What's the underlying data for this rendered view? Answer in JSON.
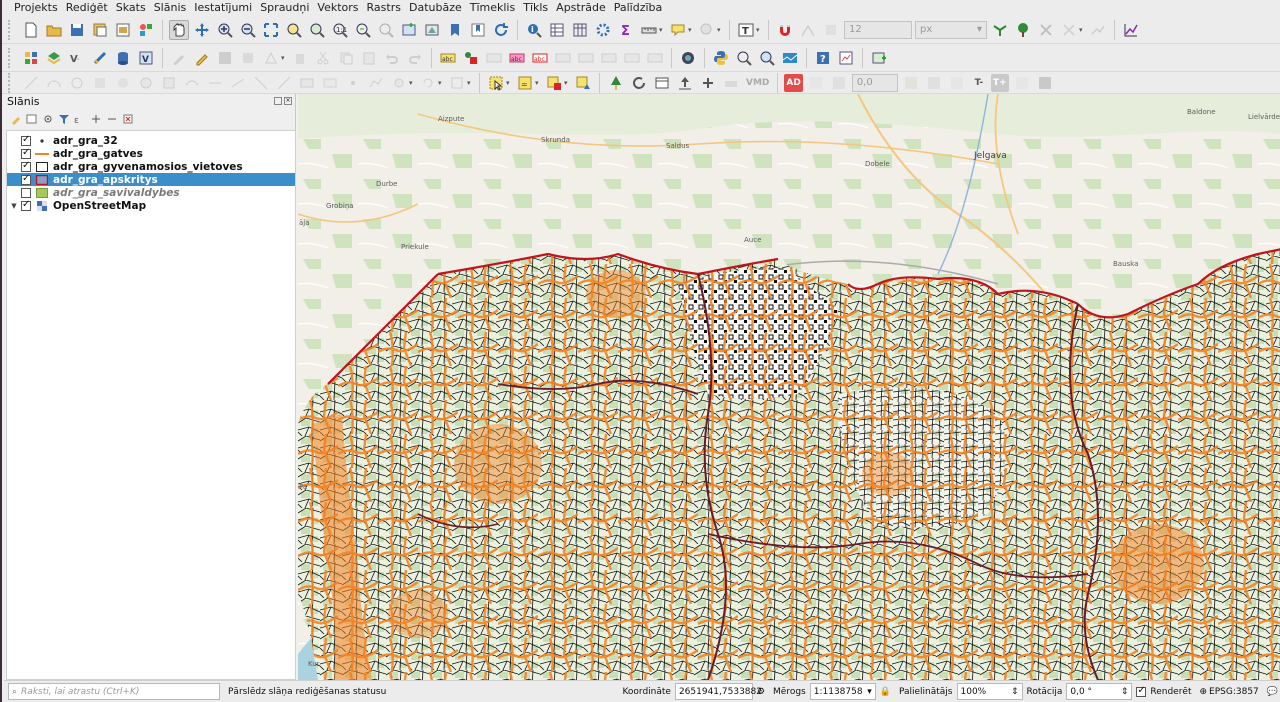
{
  "menubar": {
    "items": [
      "Projekts",
      "Rediģēt",
      "Skats",
      "Slānis",
      "Iestatījumi",
      "Spraudņi",
      "Vektors",
      "Rastrs",
      "Datubāze",
      "Tīmeklis",
      "Tīkls",
      "Apstrāde",
      "Palīdzība"
    ]
  },
  "toolbar1": {
    "font_size_value": "12",
    "unit_value": "px"
  },
  "toolbar3": {
    "ad_label": "AD",
    "vmd_label": "VMD",
    "angle_value": "0,0",
    "t_minus": "T-",
    "t_plus": "T+"
  },
  "layers_panel": {
    "title": "Slānis",
    "layers": [
      {
        "name": "adr_gra_32",
        "checked": true,
        "symbol": "point",
        "selected": false,
        "italic": false
      },
      {
        "name": "adr_gra_gatves",
        "checked": true,
        "symbol": "line",
        "selected": false,
        "italic": false
      },
      {
        "name": "adr_gra_gyvenamosios_vietoves",
        "checked": true,
        "symbol": "polygon-white",
        "selected": false,
        "italic": false
      },
      {
        "name": "adr_gra_apskritys",
        "checked": true,
        "symbol": "polygon-red",
        "selected": true,
        "italic": false
      },
      {
        "name": "adr_gra_savivaldybes",
        "checked": false,
        "symbol": "polygon-green",
        "selected": false,
        "italic": true
      },
      {
        "name": "OpenStreetMap",
        "checked": true,
        "symbol": "raster",
        "selected": false,
        "italic": false
      }
    ]
  },
  "map": {
    "labels": [
      "Aizpute",
      "Skrunda",
      "Saldus",
      "Dobele",
      "Jelgava",
      "Baldone",
      "Lielvārde",
      "Durbe",
      "Grobiņa",
      "Priekule",
      "Auce",
      "Bauska",
      "āja",
      "Pa",
      "Kur"
    ],
    "colors": {
      "roads": "#f58220",
      "county_border": "#c0141c",
      "municipality_border": "#111111",
      "forest": "#c8dfb6",
      "background": "#f2efe9"
    }
  },
  "statusbar": {
    "search_placeholder": "Raksti, lai atrastu (Ctrl+K)",
    "message": "Pārslēdz slāņa rediģēšanas statusu",
    "coordinate_label": "Koordināte",
    "coordinate_value": "2651941,7533882",
    "scale_label": "Mērogs",
    "scale_value": "1:1138758",
    "magnifier_label": "Palielinātājs",
    "magnifier_value": "100%",
    "rotation_label": "Rotācija",
    "rotation_value": "0,0 °",
    "render_label": "Renderēt",
    "crs_label": "EPSG:3857"
  }
}
